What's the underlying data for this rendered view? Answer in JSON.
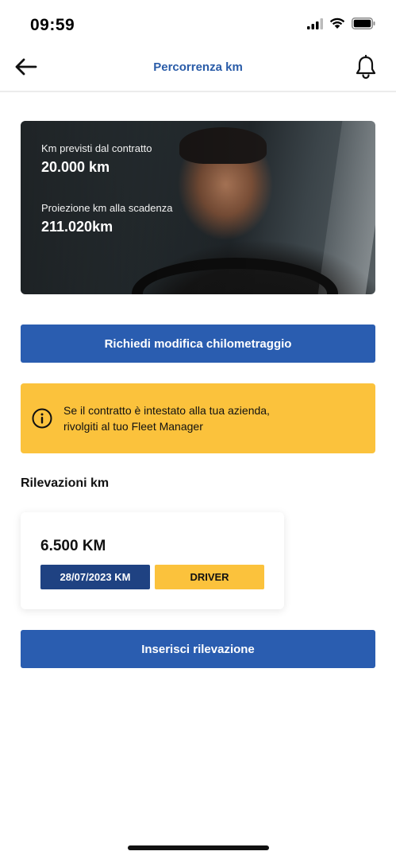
{
  "status_bar": {
    "time": "09:59",
    "icons": [
      "cellular-signal-icon",
      "wifi-icon",
      "battery-icon"
    ]
  },
  "nav": {
    "title": "Percorrenza km",
    "back_icon": "arrow-left-icon",
    "notifications_icon": "bell-icon"
  },
  "hero": {
    "contract_label": "Km previsti dal contratto",
    "contract_value": "20.000 km",
    "projection_label": "Proiezione km alla scadenza",
    "projection_value": "211.020km"
  },
  "actions": {
    "request_change_label": "Richiedi modifica chilometraggio",
    "insert_reading_label": "Inserisci rilevazione"
  },
  "info_banner": {
    "icon": "info-icon",
    "line1": "Se il contratto è intestato alla tua azienda,",
    "line2": "rivolgiti al tuo Fleet Manager"
  },
  "readings": {
    "title": "Rilevazioni km",
    "items": [
      {
        "value": "6.500 KM",
        "date": "28/07/2023 KM",
        "source": "DRIVER"
      }
    ]
  },
  "colors": {
    "primary": "#2a5db0",
    "title_blue": "#2a5ca8",
    "accent_yellow": "#fbc23c",
    "date_badge": "#1f4282"
  }
}
